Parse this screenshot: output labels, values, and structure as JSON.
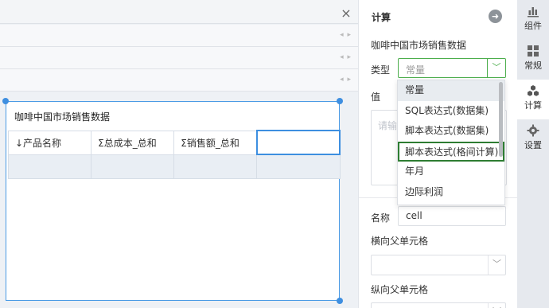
{
  "canvas": {
    "close_glyph": "×",
    "rows_arrow_glyph": "◂ ▸",
    "widget": {
      "title": "咖啡中国市场销售数据",
      "columns": [
        "↓产品名称",
        "Σ总成本_总和",
        "Σ销售额_总和",
        ""
      ]
    }
  },
  "panel": {
    "title": "计算",
    "go_glyph": "➜",
    "dataset_name": "咖啡中国市场销售数据",
    "type_label": "类型",
    "type_value": "常量",
    "value_label": "值",
    "value_placeholder": "请输",
    "name_label": "名称",
    "name_value": "cell",
    "h_parent_label": "横向父单元格",
    "v_parent_label": "纵向父单元格",
    "chevron": "﹀",
    "type_options": [
      "常量",
      "SQL表达式(数据集)",
      "脚本表达式(数据集)",
      "脚本表达式(格间计算)",
      "年月",
      "边际利润"
    ],
    "type_active_index": 0,
    "type_highlight_index": 3
  },
  "tabs": [
    {
      "label": "组件",
      "icon": "bar-chart-icon"
    },
    {
      "label": "常规",
      "icon": "grid-icon"
    },
    {
      "label": "计算",
      "icon": "cubes-icon"
    },
    {
      "label": "设置",
      "icon": "gear-icon"
    }
  ],
  "colors": {
    "accent_blue": "#3f8fe0",
    "select_green": "#4cae4c",
    "highlight_green": "#2e7d32"
  }
}
